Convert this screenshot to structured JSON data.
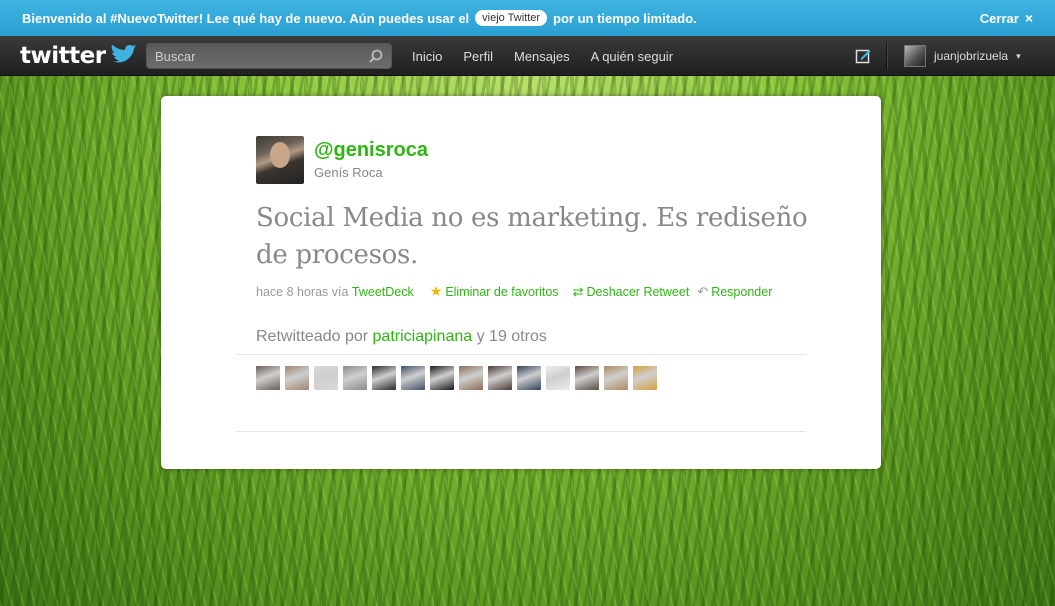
{
  "banner": {
    "msg_before": "Bienvenido al #NuevoTwitter! Lee qué hay de nuevo. Aún puedes usar el",
    "pill": "viejo Twitter",
    "msg_after": "por un tiempo limitado.",
    "close_label": "Cerrar",
    "close_icon": "×"
  },
  "topbar": {
    "logo": "twitter",
    "search_placeholder": "Buscar",
    "nav": [
      "Inicio",
      "Perfil",
      "Mensajes",
      "A quién seguir"
    ],
    "username": "juanjobrizuela",
    "caret": "▾"
  },
  "tweet": {
    "handle": "@genisroca",
    "name": "Genís Roca",
    "text": "Social Media no es marketing. Es rediseño de procesos.",
    "time": "hace 8 horas vía",
    "source": "TweetDeck",
    "fav_label": "Eliminar de favoritos",
    "rt_label": "Deshacer Retweet",
    "reply_label": "Responder",
    "star_icon": "★",
    "rt_icon": "⇄",
    "reply_icon": "↶"
  },
  "retweets": {
    "prefix": "Retwitteado por",
    "user": "patriciapinana",
    "suffix": "y 19 otros",
    "avatar_colors": [
      "#6b5e55",
      "#a1846e",
      "#d8d8d8",
      "#8a8a8a",
      "#2a2a2a",
      "#3f4f66",
      "#1a1a1a",
      "#8b6d5a",
      "#4a3a30",
      "#30435a",
      "#ececec",
      "#5a4a40",
      "#b08a5a",
      "#d6a140"
    ]
  },
  "colors": {
    "accent": "#2eb512",
    "banner": "#2a9fd2",
    "topbar": "#2a2a2a"
  }
}
